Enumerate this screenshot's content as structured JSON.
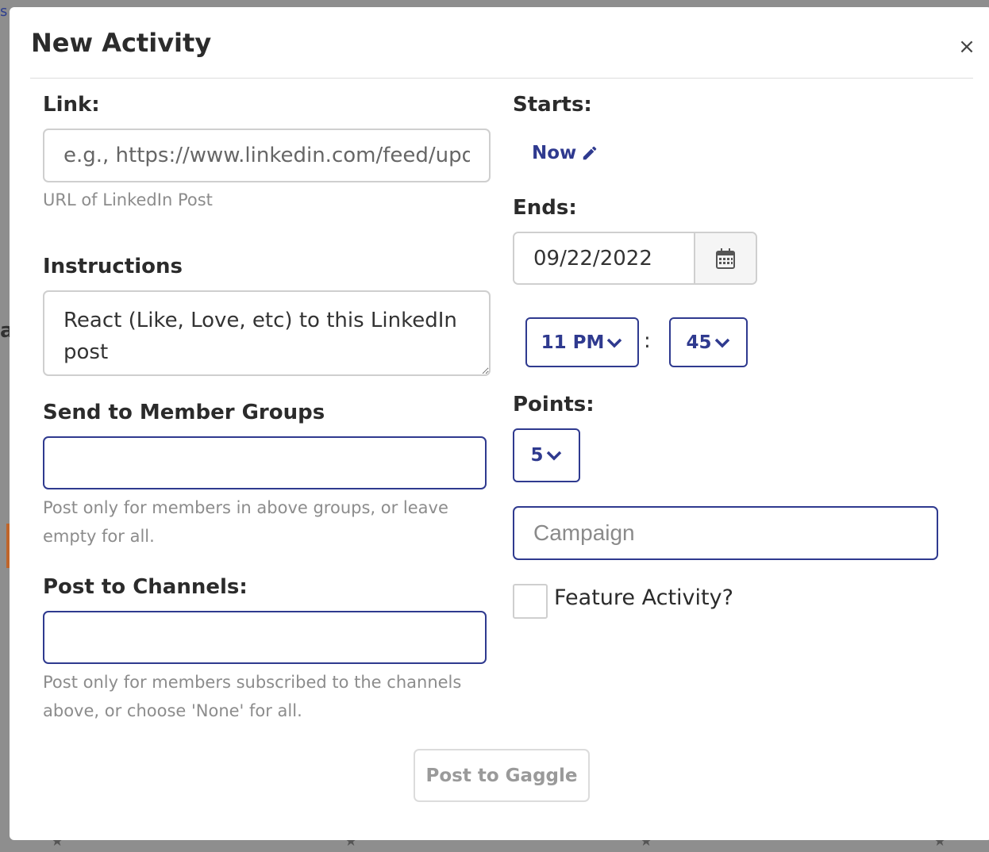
{
  "modal": {
    "title": "New Activity",
    "close_label": "×"
  },
  "link": {
    "label": "Link:",
    "placeholder": "e.g., https://www.linkedin.com/feed/update/",
    "value": "",
    "help": "URL of LinkedIn Post"
  },
  "instructions": {
    "label": "Instructions",
    "value": "React (Like, Love, etc) to this LinkedIn post"
  },
  "member_groups": {
    "label": "Send to Member Groups",
    "value": "",
    "help": "Post only for members in above groups, or leave empty for all."
  },
  "channels": {
    "label": "Post to Channels:",
    "value": "",
    "help": "Post only for members subscribed to the channels above, or choose 'None' for all."
  },
  "starts": {
    "label": "Starts:",
    "value_link": "Now",
    "edit_icon": "pencil-icon"
  },
  "ends": {
    "label": "Ends:",
    "date": "09/22/2022",
    "calendar_icon": "calendar-icon",
    "hour": "11 PM",
    "separator": ":",
    "minute": "45"
  },
  "points": {
    "label": "Points:",
    "value": "5"
  },
  "campaign": {
    "placeholder": "Campaign",
    "value": ""
  },
  "feature": {
    "label": "Feature Activity?",
    "checked": false
  },
  "submit": {
    "label": "Post to Gaggle"
  },
  "colors": {
    "accent": "#2f3a8f",
    "text": "#2b2b2b",
    "muted": "#8c8c8c",
    "border": "#cfcfcf",
    "overlay": "#8e8e8e"
  }
}
